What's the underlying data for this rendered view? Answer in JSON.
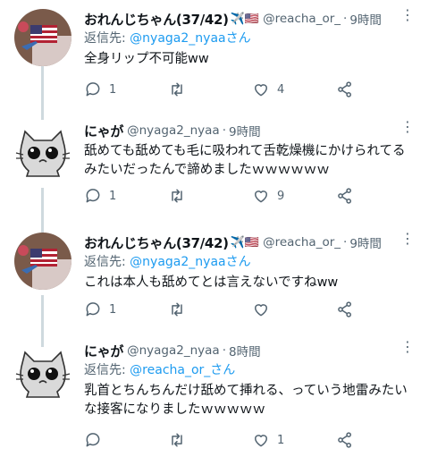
{
  "tweets": [
    {
      "name": "おれんじちゃん(37/42)",
      "badge": "✈️🇺🇸",
      "handle": "@reacha_or_",
      "time": "9時間",
      "reply_prefix": "返信先: ",
      "reply_handle": "@nyaga2_nyaaさん",
      "text": "全身リップ不可能ww",
      "reply_count": "1",
      "retweet_count": "",
      "like_count": "4"
    },
    {
      "name": "にゃが",
      "badge": "",
      "handle": "@nyaga2_nyaa",
      "time": "9時間",
      "reply_prefix": "",
      "reply_handle": "",
      "text": "舐めても舐めても毛に吸われて舌乾燥機にかけられてるみたいだったんで諦めましたｗｗｗｗｗｗ",
      "reply_count": "1",
      "retweet_count": "",
      "like_count": "9"
    },
    {
      "name": "おれんじちゃん(37/42)",
      "badge": "✈️🇺🇸",
      "handle": "@reacha_or_",
      "time": "9時間",
      "reply_prefix": "返信先: ",
      "reply_handle": "@nyaga2_nyaaさん",
      "text": "これは本人も舐めてとは言えないですねww",
      "reply_count": "1",
      "retweet_count": "",
      "like_count": ""
    },
    {
      "name": "にゃが",
      "badge": "",
      "handle": "@nyaga2_nyaa",
      "time": "8時間",
      "reply_prefix": "返信先: ",
      "reply_handle": "@reacha_or_さん",
      "text": "乳首とちんちんだけ舐めて挿れる、っていう地雷みたいな接客になりましたｗｗｗｗｗ",
      "reply_count": "",
      "retweet_count": "",
      "like_count": "1"
    }
  ],
  "separator": "·",
  "more": "⋮",
  "colors": {
    "accent": "#1d9bf0",
    "muted": "#536471",
    "thread_line": "#cfd9de"
  }
}
